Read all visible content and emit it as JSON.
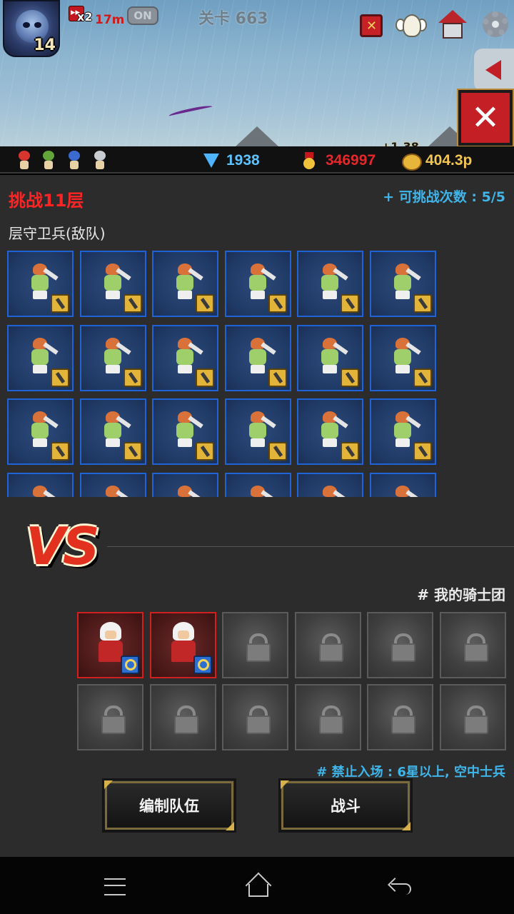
{
  "top_bar": {
    "player_level": "14",
    "speed_multiplier": "x2",
    "speed_time": "17m",
    "toggle_label": "ON",
    "stage_title": "关卡 663",
    "floating_gold": "+1.38",
    "icons": [
      "guild-flag-icon",
      "angel-icon",
      "house-icon",
      "gear-icon",
      "arrow-left-icon",
      "close-icon"
    ]
  },
  "resources": {
    "gems": "1938",
    "medals": "346997",
    "gold": "404.3p"
  },
  "challenge": {
    "title": "挑战11层",
    "attempts_label": "+ 可挑战次数 : 5/5",
    "enemy_section_label": "层守卫兵(敌队)",
    "enemy_visible_count": 24
  },
  "versus_label": "VS",
  "my_team": {
    "label": "# 我的骑士团",
    "heroes_placed": 2,
    "locked_slots": 10,
    "restriction": "# 禁止入场 : 6星以上, 空中士兵"
  },
  "buttons": {
    "edit_team": "编制队伍",
    "battle": "战斗",
    "close": "✕"
  },
  "colors": {
    "challenge_red": "#ff2424",
    "info_blue": "#3fb5ea",
    "enemy_border": "#1f63d6",
    "hero_border": "#d12020",
    "gem_blue": "#5cc2ff",
    "medal_red": "#e3272b",
    "gold_yellow": "#f0c552"
  }
}
